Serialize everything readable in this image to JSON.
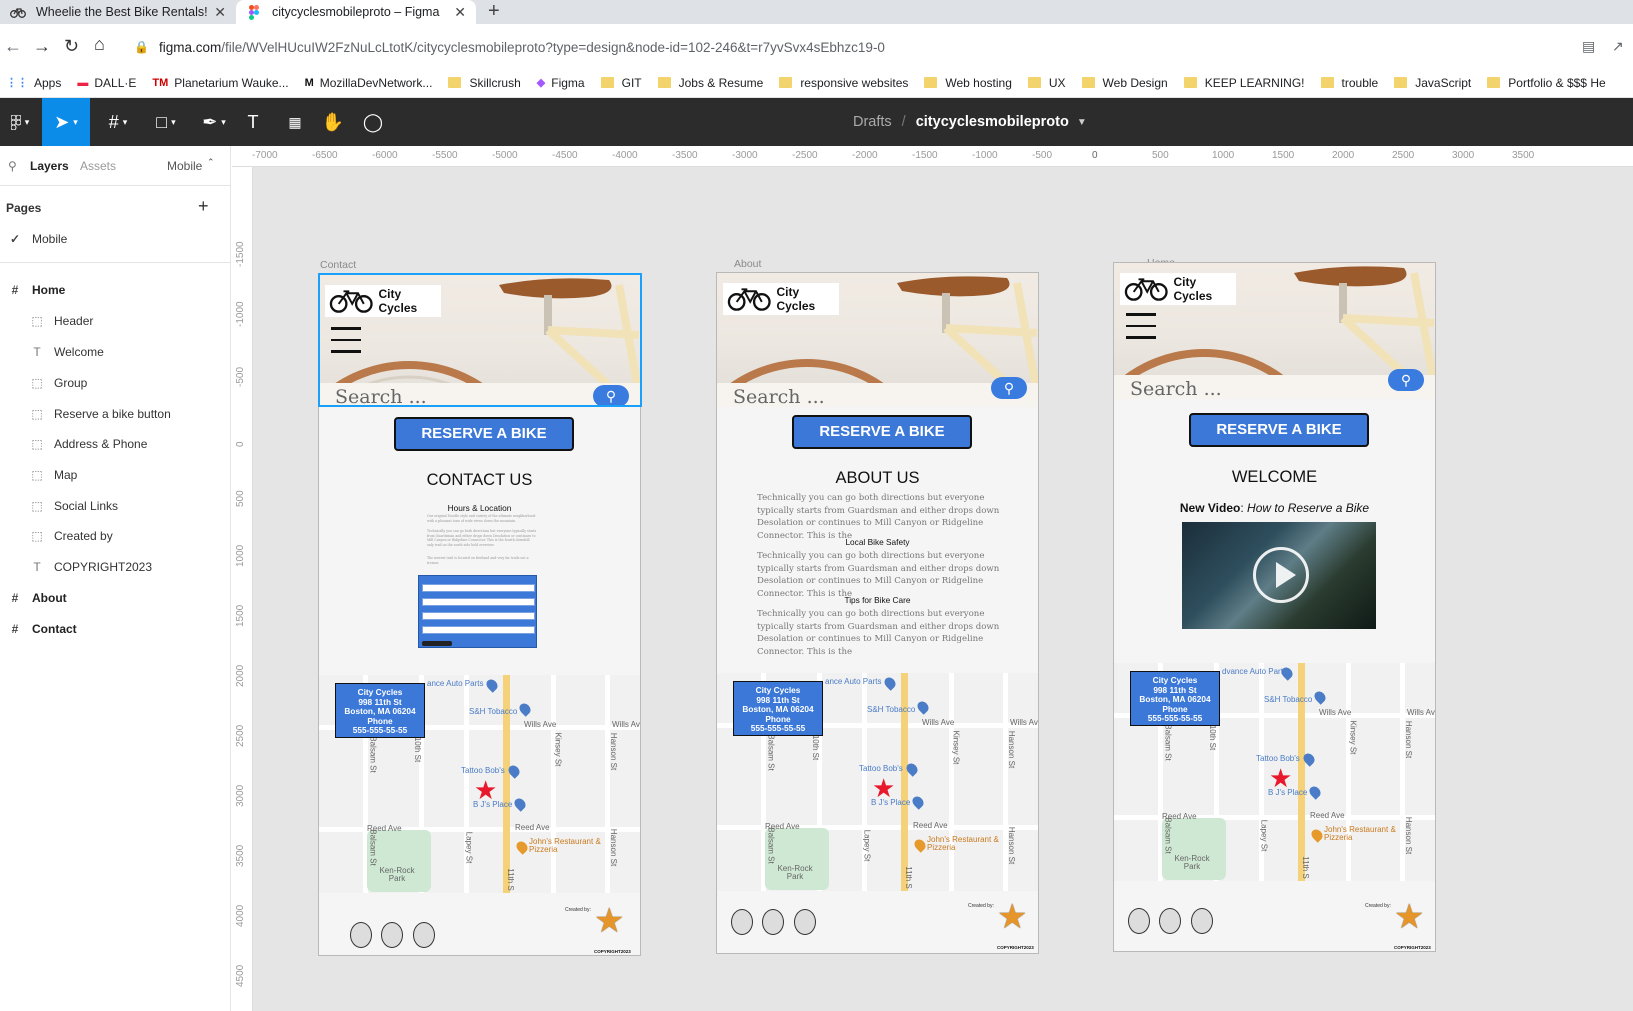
{
  "browser": {
    "tabs": [
      {
        "title": "Wheelie the Best Bike Rentals!",
        "active": false
      },
      {
        "title": "citycyclesmobileproto – Figma",
        "active": true
      }
    ],
    "new_tab": "+",
    "close": "✕",
    "url_host": "figma.com",
    "url_path": "/file/WVelHUcuIW2FzNuLcLtotK/citycyclesmobileproto?type=design&node-id=102-246&t=r7yvSvx4sEbhzc19-0"
  },
  "bookmarks": [
    {
      "label": "Apps",
      "type": "apps"
    },
    {
      "label": "DALL·E",
      "type": "site"
    },
    {
      "label": "Planetarium Wauke...",
      "type": "site"
    },
    {
      "label": "MozillaDevNetwork...",
      "type": "site"
    },
    {
      "label": "Skillcrush",
      "type": "folder"
    },
    {
      "label": "Figma",
      "type": "site"
    },
    {
      "label": "GIT",
      "type": "folder"
    },
    {
      "label": "Jobs & Resume",
      "type": "folder"
    },
    {
      "label": "responsive websites",
      "type": "folder"
    },
    {
      "label": "Web hosting",
      "type": "folder"
    },
    {
      "label": "UX",
      "type": "folder"
    },
    {
      "label": "Web Design",
      "type": "folder"
    },
    {
      "label": "KEEP LEARNING!",
      "type": "folder"
    },
    {
      "label": "trouble",
      "type": "folder"
    },
    {
      "label": "JavaScript",
      "type": "folder"
    },
    {
      "label": "Portfolio & $$$ He",
      "type": "folder"
    }
  ],
  "figma": {
    "breadcrumb": {
      "drafts": "Drafts",
      "separator": "/",
      "file": "citycyclesmobileproto"
    },
    "tools": [
      "main-menu-icon",
      "move-tool-icon",
      "frame-tool-icon",
      "shape-tool-icon",
      "pen-tool-icon",
      "text-tool-icon",
      "resources-icon",
      "hand-tool-icon",
      "comment-icon"
    ]
  },
  "left_panel": {
    "tab_layers": "Layers",
    "tab_assets": "Assets",
    "page_switch": "Mobile",
    "pages_header": "Pages",
    "current_page": "Mobile",
    "layers": [
      {
        "label": "Home",
        "level": 0,
        "kind": "frame"
      },
      {
        "label": "Header",
        "level": 1,
        "kind": "group"
      },
      {
        "label": "Welcome",
        "level": 1,
        "kind": "text"
      },
      {
        "label": "Group",
        "level": 1,
        "kind": "group"
      },
      {
        "label": "Reserve a bike button",
        "level": 1,
        "kind": "group"
      },
      {
        "label": "Address & Phone",
        "level": 1,
        "kind": "group"
      },
      {
        "label": "Map",
        "level": 1,
        "kind": "group"
      },
      {
        "label": "Social Links",
        "level": 1,
        "kind": "group"
      },
      {
        "label": "Created by",
        "level": 1,
        "kind": "group"
      },
      {
        "label": "COPYRIGHT2023",
        "level": 1,
        "kind": "text"
      },
      {
        "label": "About",
        "level": 0,
        "kind": "frame"
      },
      {
        "label": "Contact",
        "level": 0,
        "kind": "frame"
      }
    ]
  },
  "rulers": {
    "horizontal": [
      "-7000",
      "-6500",
      "-6000",
      "-5500",
      "-5000",
      "-4500",
      "-4000",
      "-3500",
      "-3000",
      "-2500",
      "-2000",
      "-1500",
      "-1000",
      "-500",
      "0",
      "500",
      "1000",
      "1500",
      "2000",
      "2500",
      "3000",
      "3500"
    ],
    "vertical": [
      "-1500",
      "-1000",
      "-500",
      "0",
      "500",
      "1000",
      "1500",
      "2000",
      "2500",
      "3000",
      "3500",
      "4000",
      "4500"
    ]
  },
  "frames": {
    "contact": {
      "label": "Contact",
      "title": "CONTACT US",
      "hours": "Hours & Location",
      "tiny1": "Our original Noodle style and variety of the ultimate neighborhood with a pleasant tone of wide views down the mountain.",
      "tiny2": "Technically you can go both directions but everyone typically starts from Guardsman and either drops down Desolation or continues to Mill Canyon or Ridgeline Connector. This is the fourth downhill only trail on the north side hold overview.",
      "tiny3": "The newest trail is located on freeland and very far trails out a tremor."
    },
    "about": {
      "label": "About",
      "title": "ABOUT US",
      "para": "Technically you can go both directions but everyone typically starts from Guardsman and either drops down Desolation or continues to Mill Canyon or Ridgeline Connector. This is the",
      "h1": "Local Bike Safety",
      "h2": "Tips for Bike Care"
    },
    "home": {
      "label": "Home",
      "title": "WELCOME",
      "video_prefix": "New Video",
      "video_colon": ": ",
      "video_title": "How to Reserve a Bike"
    },
    "common": {
      "brand": "City Cycles",
      "search": "Search ...",
      "reserve": "RESERVE A BIKE",
      "address": [
        "City Cycles",
        "998 11th St",
        "Boston, MA 06204",
        "Phone",
        "555-555-55-55"
      ],
      "created_by": "Created by:",
      "copyright": "COPYRIGHT2023",
      "map_labels": {
        "auto": "dvance Auto Parts",
        "auto_c": "ance Auto Parts",
        "tobacco": "S&H Tobacco",
        "tattoo": "Tattoo Bob's",
        "bjs": "B J's Place",
        "johns": "John's Restaurant & Pizzeria",
        "wills": "Wills Ave",
        "reed": "Reed Ave",
        "park": "Ken-Rock Park",
        "balsam": "Balsam St",
        "tenth": "10th St",
        "kinsey": "Kinsey St",
        "hanson": "Hanson St",
        "lapey": "Lapey St",
        "eleventh": "11th S"
      }
    }
  }
}
